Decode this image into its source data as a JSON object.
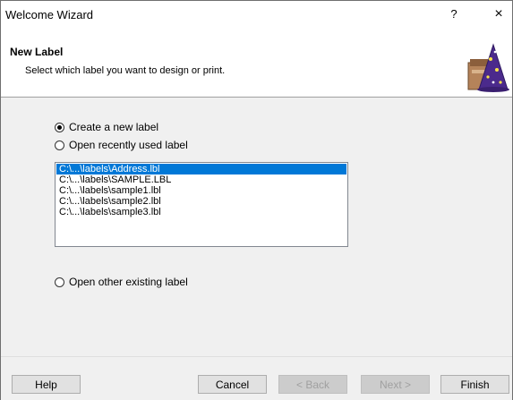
{
  "window": {
    "title": "Welcome Wizard",
    "help_glyph": "?",
    "close_glyph": "×"
  },
  "header": {
    "title": "New Label",
    "subtitle": "Select which label you want to design or print.",
    "icon": "wizard-hat-icon"
  },
  "options": {
    "create_new": "Create a new label",
    "open_recent": "Open recently used label",
    "open_other": "Open other existing label",
    "selected": "create_new"
  },
  "recent_files": [
    "C:\\...\\labels\\Address.lbl",
    "C:\\...\\labels\\SAMPLE.LBL",
    "C:\\...\\labels\\sample1.lbl",
    "C:\\...\\labels\\sample2.lbl",
    "C:\\...\\labels\\sample3.lbl"
  ],
  "selected_file_index": 0,
  "buttons": {
    "help": "Help",
    "cancel": "Cancel",
    "back": "< Back",
    "next": "Next >",
    "finish": "Finish"
  },
  "colors": {
    "selection": "#0078d7",
    "body_bg": "#f0f0f0",
    "hat": "#4b2a8c"
  }
}
